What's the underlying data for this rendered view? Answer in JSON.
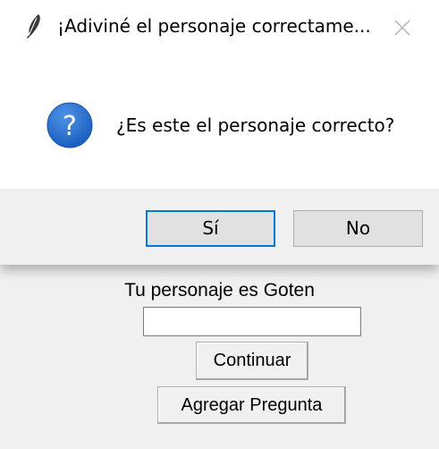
{
  "dialog": {
    "title": "¡Adiviné el personaje correctame...",
    "title_icon": "feather-icon",
    "close_icon": "close-icon",
    "message_icon": "question-icon",
    "message_icon_glyph": "?",
    "message": "¿Es este el personaje correcto?",
    "buttons": {
      "yes": "Sí",
      "no": "No"
    },
    "colors": {
      "accent": "#0078d7",
      "question_blue": "#1e66c8"
    }
  },
  "main_window": {
    "result_label": "Tu personaje es Goten",
    "entry_value": "",
    "continue_button": "Continuar",
    "add_question_button": "Agregar Pregunta"
  }
}
